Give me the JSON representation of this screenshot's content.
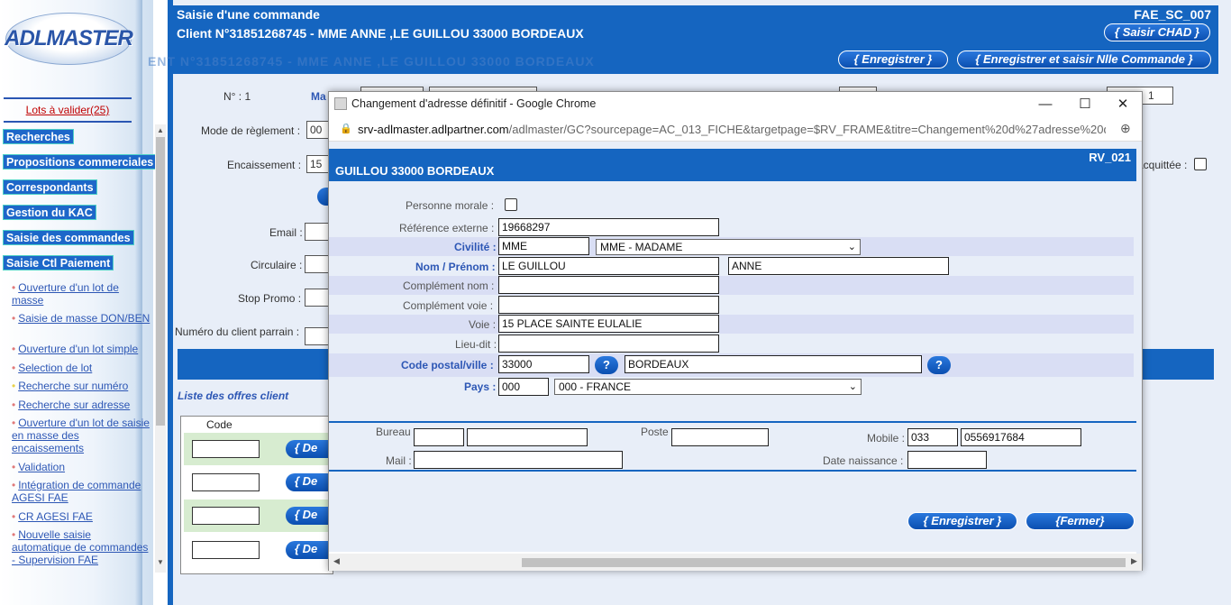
{
  "sidebar": {
    "logo": "ADLMASTER",
    "lots_link": "Lots à valider(25)",
    "nav": [
      "Recherches",
      "Propositions commerciales",
      "Correspondants",
      "Gestion du KAC",
      "Saisie des commandes",
      "Saisie Ctl Paiement"
    ],
    "links": [
      "Ouverture d'un lot de masse",
      "Saisie de masse DON/BEN",
      "Ouverture d'un lot simple",
      "Selection de lot",
      "Recherche sur numéro",
      "Recherche sur adresse",
      "Ouverture d'un lot de saisie en masse des encaissements",
      "Validation",
      "Intégration de commande AGESI FAE",
      "CR AGESI FAE",
      "Nouvelle saisie automatique de commandes - Supervision FAE"
    ]
  },
  "main": {
    "title": "Saisie d'une commande",
    "client": "Client N°31851268745 - MME ANNE ,LE GUILLOU 33000 BORDEAUX",
    "code": "FAE_SC_007",
    "ghost": "ENT N°31851268745 - MME ANNE ,LE GUILLOU 33000 BORDEAUX",
    "btn_saisir_chad": "{ Saisir CHAD }",
    "btn_enregistrer": "{ Enregistrer }",
    "btn_enregistrer_nlle": "{ Enregistrer et saisir Nlle Commande }",
    "labels": {
      "num": "N° : 1",
      "ma": "Ma",
      "mode_reglement": "Mode de règlement :",
      "encaissement": "Encaissement :",
      "email": "Email :",
      "circulaire": "Circulaire :",
      "stop_promo": "Stop Promo :",
      "numero_parrain": "Numéro du client parrain :",
      "acquittee": "acquittée :"
    },
    "values": {
      "mode_reglement": "00",
      "encaissement": "15",
      "right_box_tail": "1"
    },
    "offres_title": "Liste des offres client",
    "code_header": "Code",
    "de_button": "{ De"
  },
  "popup": {
    "window_title": "Changement d'adresse définitif - Google Chrome",
    "url_host": "srv-adlmaster.adlpartner.com",
    "url_path": "/adlmaster/GC?sourcepage=AC_013_FICHE&targetpage=$RV_FRAME&titre=Changement%20d%27adresse%20d...",
    "code": "RV_021",
    "client_name": "GUILLOU 33000 BORDEAUX",
    "form": {
      "personne_morale_label": "Personne morale :",
      "ref_externe_label": "Référence externe :",
      "ref_externe": "19668297",
      "civilite_label": "Civilité :",
      "civilite_code": "MME",
      "civilite_select": "MME - MADAME",
      "nom_prenom_label": "Nom / Prénom :",
      "nom": "LE GUILLOU",
      "prenom": "ANNE",
      "complement_nom_label": "Complément nom :",
      "complement_voie_label": "Complément voie :",
      "voie_label": "Voie :",
      "voie": "15 PLACE SAINTE EULALIE",
      "lieu_dit_label": "Lieu-dit :",
      "cp_ville_label": "Code postal/ville :",
      "code_postal": "33000",
      "ville": "BORDEAUX",
      "pays_label": "Pays :",
      "pays_code": "000",
      "pays_select": "000 - FRANCE",
      "bureau_label": "Bureau :",
      "poste_label": "Poste :",
      "mobile_label": "Mobile :",
      "mobile_prefix": "033",
      "mobile": "0556917684",
      "mail_label": "Mail :",
      "date_naissance_label": "Date naissance :",
      "help_glyph": "?"
    },
    "btn_enregistrer": "{ Enregistrer }",
    "btn_fermer": "{Fermer}"
  },
  "colors": {
    "brand_blue": "#1565c0",
    "link_blue": "#2d57b5",
    "alert_red": "#c00000"
  }
}
